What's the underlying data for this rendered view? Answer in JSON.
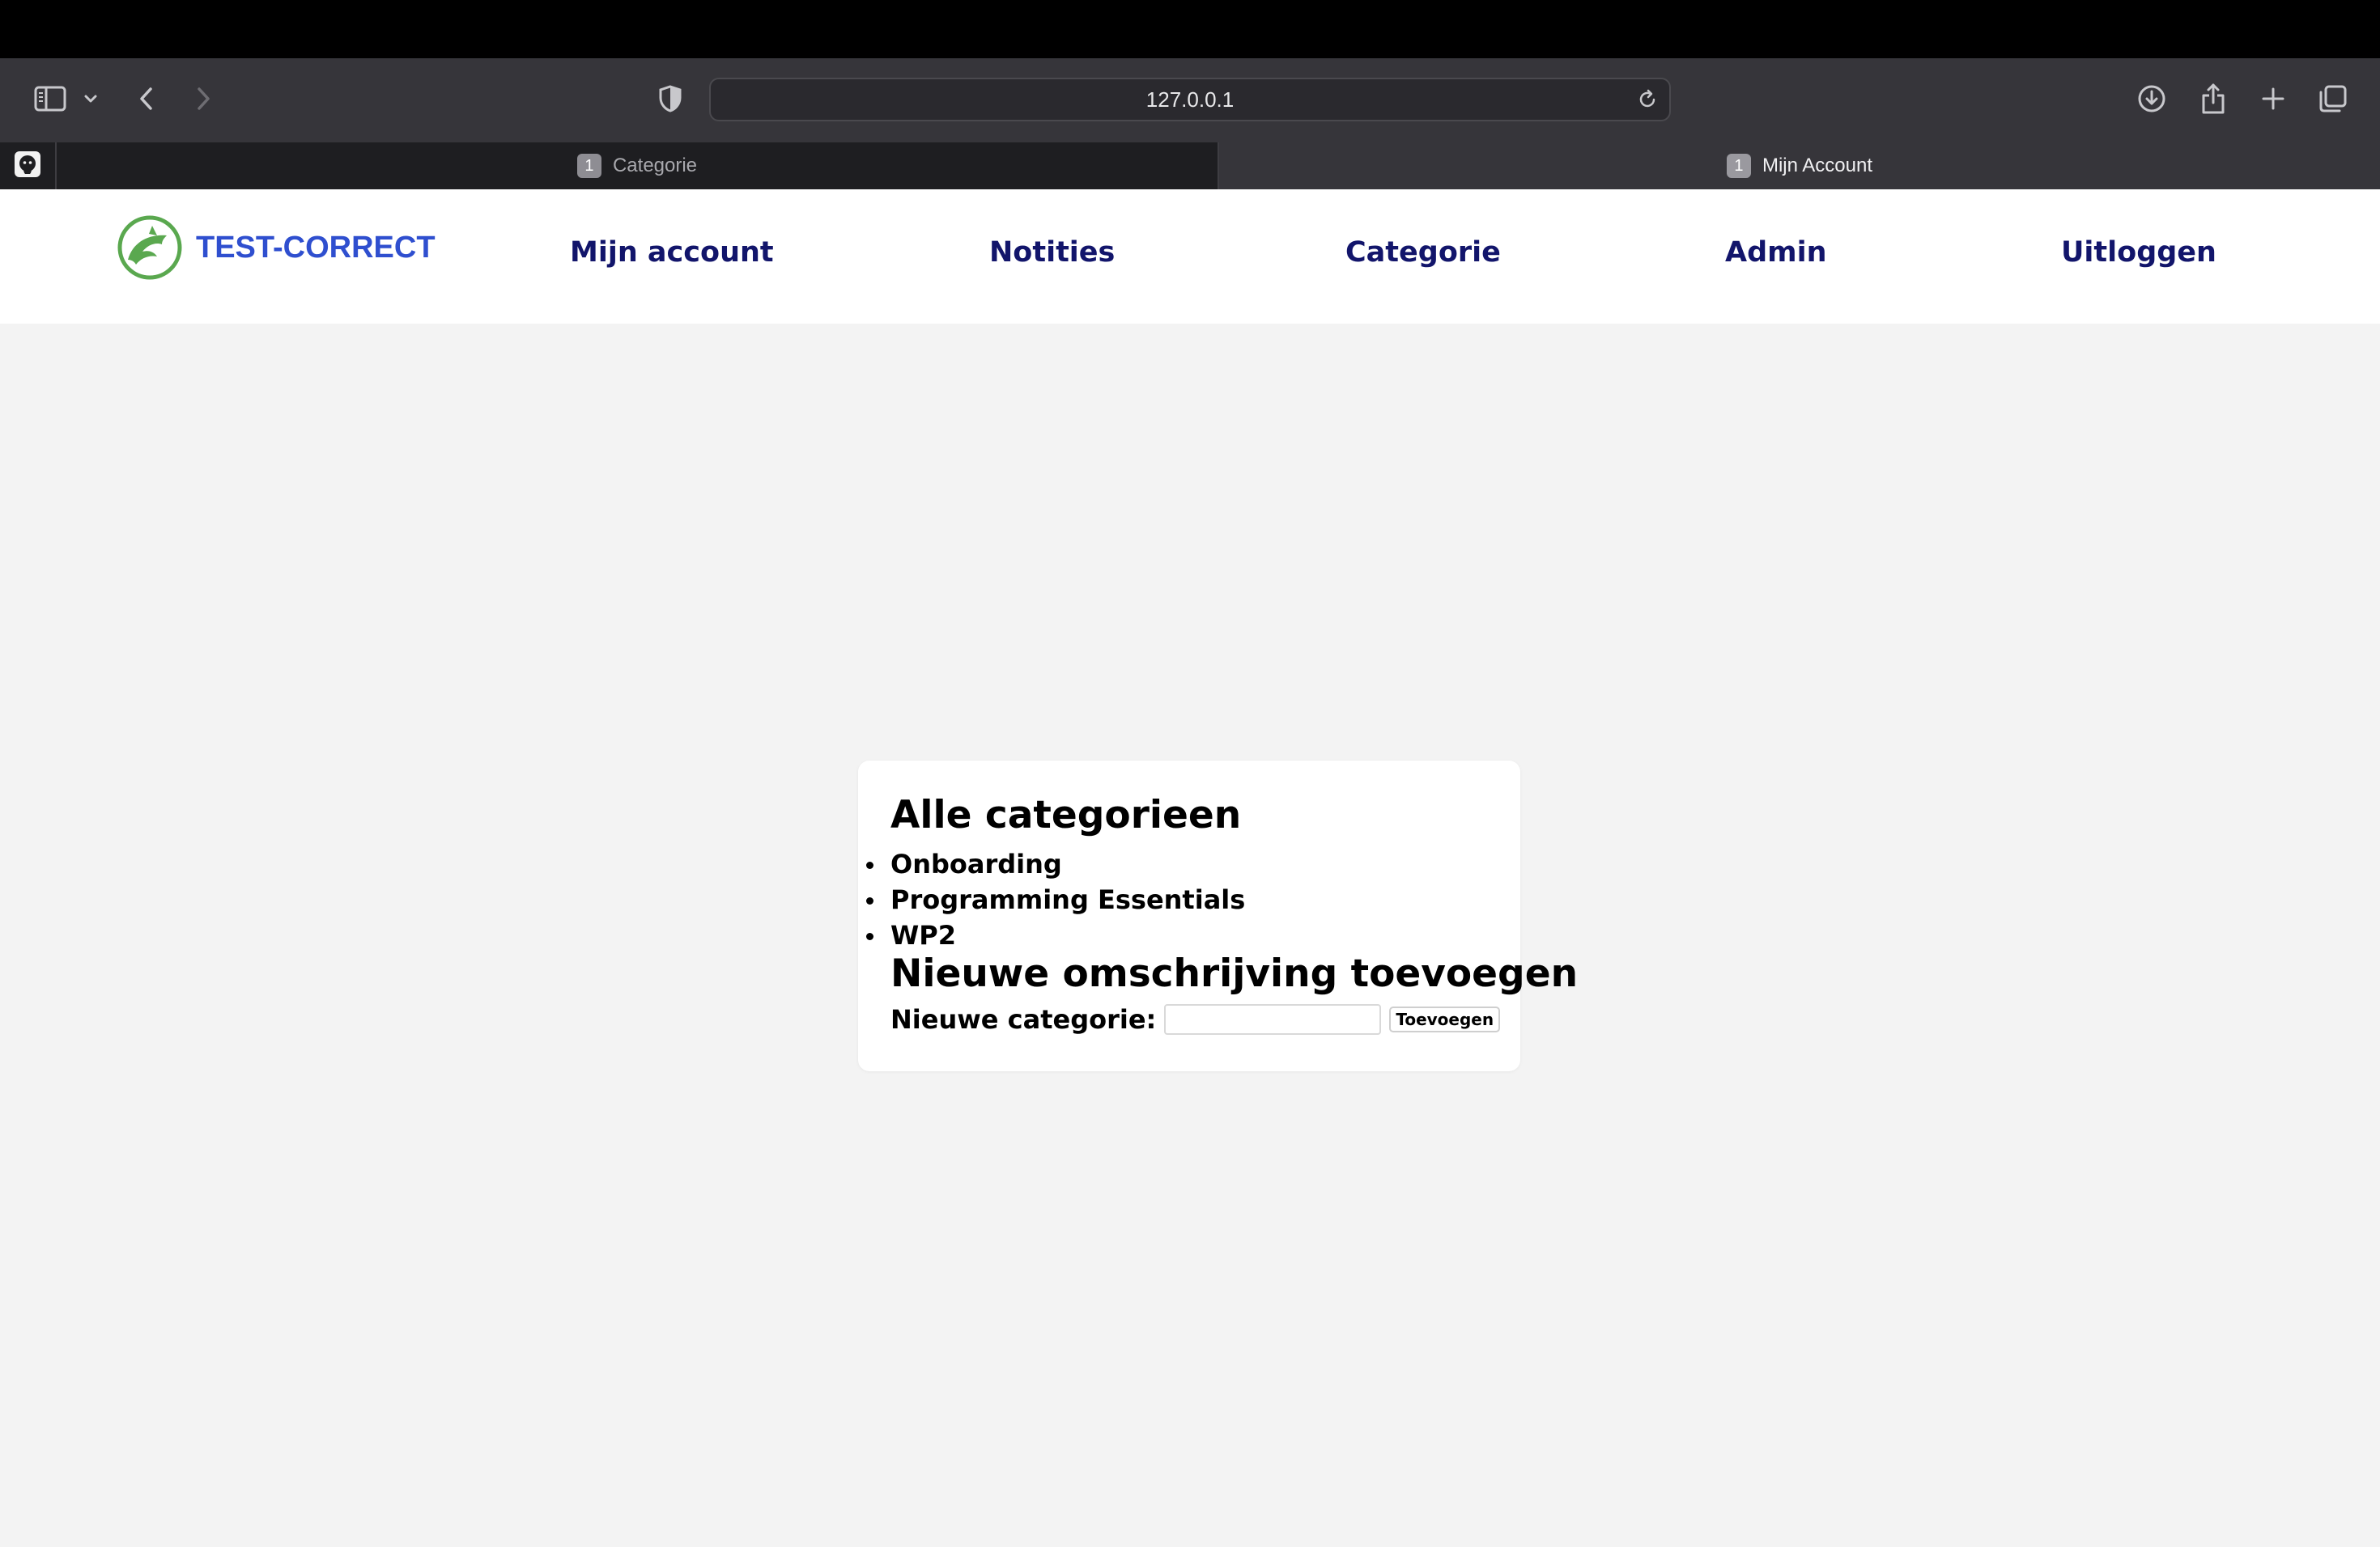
{
  "browser": {
    "url": "127.0.0.1",
    "tabs": [
      {
        "badge": "1",
        "label": "Categorie",
        "active": false
      },
      {
        "badge": "1",
        "label": "Mijn Account",
        "active": true
      }
    ],
    "icons": [
      "sidebar-icon",
      "chevron-down-icon",
      "back-icon",
      "forward-icon",
      "shield-icon",
      "reload-icon",
      "download-icon",
      "share-icon",
      "plus-icon",
      "tabs-overview-icon",
      "github-icon"
    ]
  },
  "header": {
    "logo_text": "TEST-CORRECT",
    "nav": [
      "Mijn account",
      "Notities",
      "Categorie",
      "Admin",
      "Uitloggen"
    ],
    "nav_color": "#12156b",
    "logo_color": "#2f4fcf",
    "logo_icon_color": "#5aa84f"
  },
  "main": {
    "title": "Alle categorieen",
    "categories": [
      "Onboarding",
      "Programming Essentials",
      "WP2"
    ],
    "subtitle": "Nieuwe omschrijving toevoegen",
    "form": {
      "label": "Nieuwe categorie:",
      "input_value": "",
      "button_label": "Toevoegen"
    }
  }
}
